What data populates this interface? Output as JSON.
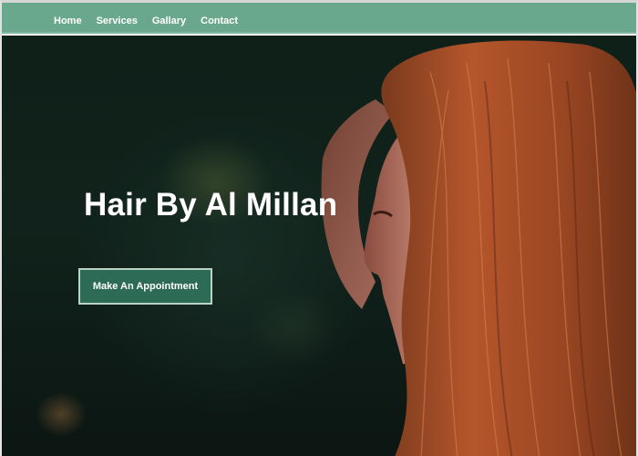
{
  "nav": {
    "items": [
      {
        "label": "Home"
      },
      {
        "label": "Services"
      },
      {
        "label": "Gallary"
      },
      {
        "label": "Contact"
      }
    ]
  },
  "hero": {
    "title": "Hair By Al Millan",
    "button_label": "Make An Appointment",
    "background_image": "woman-with-long-red-hair-profile-photo"
  },
  "colors": {
    "nav_bg": "#6aa88d",
    "button_bg": "#2e6b57",
    "hero_dark": "#0d1a16",
    "hair": "#b5562c"
  }
}
